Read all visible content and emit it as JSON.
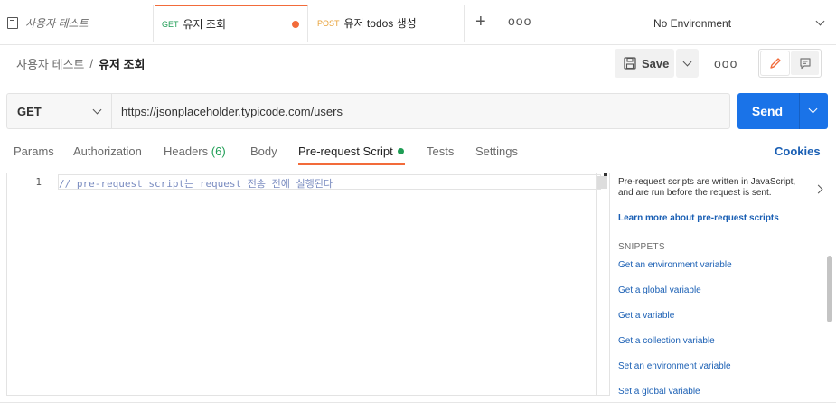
{
  "tabs": {
    "collection": {
      "label": "사용자 테스트"
    },
    "active": {
      "method": "GET",
      "label": "유저 조회"
    },
    "second": {
      "method": "POST",
      "label": "유저 todos 생성"
    },
    "new_tab": "+",
    "more": "ooo"
  },
  "environment": {
    "label": "No Environment"
  },
  "header": {
    "collection": "사용자 테스트",
    "separator": "/",
    "request_name": "유저 조회",
    "save_label": "Save",
    "more": "ooo"
  },
  "request": {
    "method": "GET",
    "url": "https://jsonplaceholder.typicode.com/users",
    "send_label": "Send"
  },
  "request_tabs": {
    "params": "Params",
    "authorization": "Authorization",
    "headers": "Headers",
    "headers_count": "(6)",
    "body": "Body",
    "pre_request": "Pre-request Script",
    "tests": "Tests",
    "settings": "Settings",
    "cookies": "Cookies"
  },
  "editor": {
    "line_number": "1",
    "code": "// pre-request script는 request 전송 전에 실행된다"
  },
  "side_panel": {
    "description": "Pre-request scripts are written in JavaScript, and are run before the request is sent.",
    "learn_more": "Learn more about pre-request scripts",
    "snippets_heading": "SNIPPETS",
    "snippets": [
      "Get an environment variable",
      "Get a global variable",
      "Get a variable",
      "Get a collection variable",
      "Set an environment variable",
      "Set a global variable"
    ]
  },
  "colors": {
    "accent": "#f26b3a",
    "send": "#1a73e8",
    "link": "#1a5fb4",
    "get": "#1f9d55",
    "post": "#e8a23a"
  }
}
